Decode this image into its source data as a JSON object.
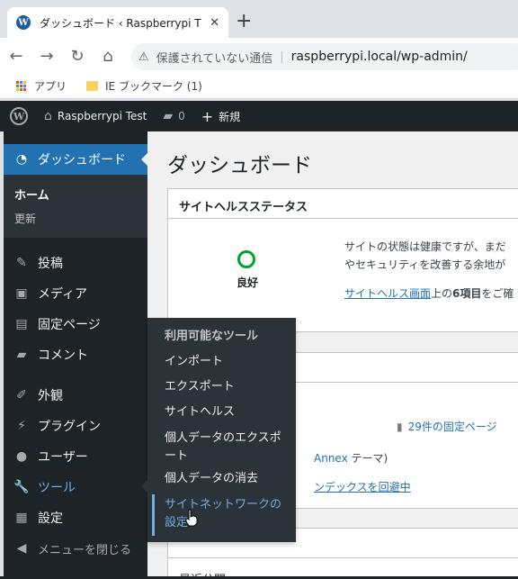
{
  "browser": {
    "tab_title": "ダッシュボード ‹ Raspberrypi T",
    "tab_close": "✕",
    "new_tab": "+",
    "back": "←",
    "forward": "→",
    "reload": "↻",
    "home": "⌂",
    "security_warning": "保護されていない通信",
    "url": "raspberrypi.local/wp-admin/",
    "bookmarks": {
      "apps": "アプリ",
      "ie_folder": "IE ブックマーク (1)"
    }
  },
  "adminbar": {
    "site_name": "Raspberrypi Test",
    "comment_count": "0",
    "new_label": "新規"
  },
  "sidebar": {
    "dashboard": "ダッシュボード",
    "home": "ホーム",
    "updates": "更新",
    "items": [
      {
        "label": "投稿",
        "icon": "pin-icon"
      },
      {
        "label": "メディア",
        "icon": "media-icon"
      },
      {
        "label": "固定ページ",
        "icon": "pages-icon"
      },
      {
        "label": "コメント",
        "icon": "comment-icon"
      },
      {
        "label": "外観",
        "icon": "brush-icon"
      },
      {
        "label": "プラグイン",
        "icon": "plugin-icon"
      },
      {
        "label": "ユーザー",
        "icon": "user-icon"
      },
      {
        "label": "ツール",
        "icon": "wrench-icon"
      },
      {
        "label": "設定",
        "icon": "settings-icon"
      },
      {
        "label": "メニューを閉じる",
        "icon": "collapse-icon"
      }
    ]
  },
  "flyout": {
    "items": [
      "利用可能なツール",
      "インポート",
      "エクスポート",
      "サイトヘルス",
      "個人データのエクスポート",
      "個人データの消去",
      "サイトネットワークの設定"
    ]
  },
  "main": {
    "title": "ダッシュボード",
    "health_panel_title": "サイトヘルスステータス",
    "health_status": "良好",
    "health_line1": "サイトの状態は健康ですが、まだ",
    "health_line2": "やセキュリティを改善する余地が",
    "health_link": "サイトヘルス画面",
    "health_link_tail": "上の",
    "health_items": "6項目",
    "health_items_tail": "をご確",
    "pages_count": "29件の固定ページ",
    "theme_name": "Annex",
    "theme_suffix": "テーマ)",
    "search_index": "ンデックスを回避中",
    "recent_published": "最近公開"
  },
  "colors": {
    "admin_bg": "#1d2327",
    "accent": "#2271b1",
    "active_link": "#72aee6",
    "health_good": "#00a32a"
  }
}
